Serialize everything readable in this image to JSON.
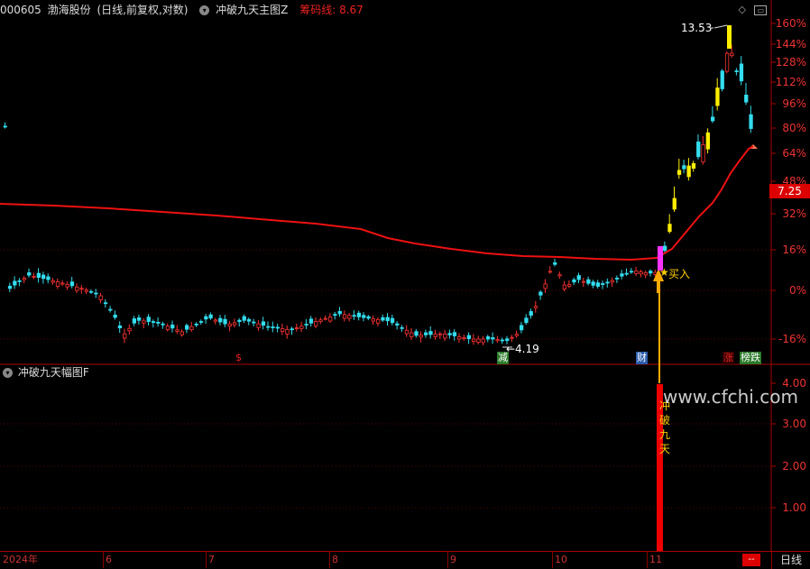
{
  "header": {
    "code": "000605",
    "name": "渤海股份",
    "period_info": "(日线,前复权,对数)",
    "indicator_main": "冲破九天主图Z",
    "cost_label": "筹码线:",
    "cost_value": "8.67"
  },
  "sub_panel": {
    "title": "冲破九天幅图F"
  },
  "price_axis": [
    "160%",
    "144%",
    "128%",
    "112%",
    "96%",
    "80%",
    "64%",
    "48%",
    "32%",
    "16%",
    "0%",
    "-16%"
  ],
  "current_price": "7.25",
  "sub_axis": [
    "4.00",
    "3.00",
    "2.00",
    "1.00"
  ],
  "annotations": {
    "high_label": "13.53",
    "low_label": "4.19",
    "buy_label": "买入",
    "signal_text": [
      "冲",
      "破",
      "九",
      "天"
    ],
    "watermark": "www.cfchi.com"
  },
  "markers": [
    {
      "text": "$",
      "color": "#e22"
    },
    {
      "text": "减",
      "color": "#fff",
      "bg": "#2a7a2a"
    },
    {
      "text": "财",
      "color": "#fff",
      "bg": "#2a5aaa"
    },
    {
      "text": "涨",
      "color": "#e22",
      "bg": "#330000"
    },
    {
      "text": "榜跌",
      "color": "#fff",
      "bg": "#2a7a2a"
    }
  ],
  "time_axis": [
    "2024年",
    "6",
    "7",
    "8",
    "9",
    "10",
    "11"
  ],
  "period_button": "日线",
  "end_marker": "--",
  "colors": {
    "up": "#ff3333",
    "down": "#33ddee",
    "ma": "#ee1111",
    "highlight": "#ffee00",
    "magenta": "#ff33ff"
  }
}
